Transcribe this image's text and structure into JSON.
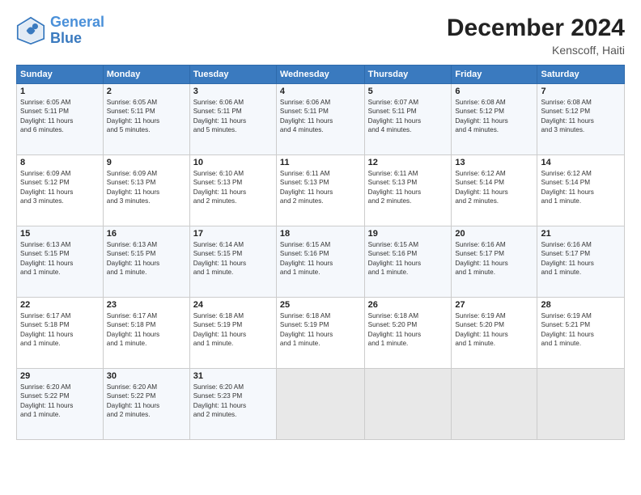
{
  "header": {
    "logo_line1": "General",
    "logo_line2": "Blue",
    "month_title": "December 2024",
    "location": "Kenscoff, Haiti"
  },
  "days_of_week": [
    "Sunday",
    "Monday",
    "Tuesday",
    "Wednesday",
    "Thursday",
    "Friday",
    "Saturday"
  ],
  "weeks": [
    [
      {
        "day": "1",
        "info": "Sunrise: 6:05 AM\nSunset: 5:11 PM\nDaylight: 11 hours\nand 6 minutes."
      },
      {
        "day": "2",
        "info": "Sunrise: 6:05 AM\nSunset: 5:11 PM\nDaylight: 11 hours\nand 5 minutes."
      },
      {
        "day": "3",
        "info": "Sunrise: 6:06 AM\nSunset: 5:11 PM\nDaylight: 11 hours\nand 5 minutes."
      },
      {
        "day": "4",
        "info": "Sunrise: 6:06 AM\nSunset: 5:11 PM\nDaylight: 11 hours\nand 4 minutes."
      },
      {
        "day": "5",
        "info": "Sunrise: 6:07 AM\nSunset: 5:11 PM\nDaylight: 11 hours\nand 4 minutes."
      },
      {
        "day": "6",
        "info": "Sunrise: 6:08 AM\nSunset: 5:12 PM\nDaylight: 11 hours\nand 4 minutes."
      },
      {
        "day": "7",
        "info": "Sunrise: 6:08 AM\nSunset: 5:12 PM\nDaylight: 11 hours\nand 3 minutes."
      }
    ],
    [
      {
        "day": "8",
        "info": "Sunrise: 6:09 AM\nSunset: 5:12 PM\nDaylight: 11 hours\nand 3 minutes."
      },
      {
        "day": "9",
        "info": "Sunrise: 6:09 AM\nSunset: 5:13 PM\nDaylight: 11 hours\nand 3 minutes."
      },
      {
        "day": "10",
        "info": "Sunrise: 6:10 AM\nSunset: 5:13 PM\nDaylight: 11 hours\nand 2 minutes."
      },
      {
        "day": "11",
        "info": "Sunrise: 6:11 AM\nSunset: 5:13 PM\nDaylight: 11 hours\nand 2 minutes."
      },
      {
        "day": "12",
        "info": "Sunrise: 6:11 AM\nSunset: 5:13 PM\nDaylight: 11 hours\nand 2 minutes."
      },
      {
        "day": "13",
        "info": "Sunrise: 6:12 AM\nSunset: 5:14 PM\nDaylight: 11 hours\nand 2 minutes."
      },
      {
        "day": "14",
        "info": "Sunrise: 6:12 AM\nSunset: 5:14 PM\nDaylight: 11 hours\nand 1 minute."
      }
    ],
    [
      {
        "day": "15",
        "info": "Sunrise: 6:13 AM\nSunset: 5:15 PM\nDaylight: 11 hours\nand 1 minute."
      },
      {
        "day": "16",
        "info": "Sunrise: 6:13 AM\nSunset: 5:15 PM\nDaylight: 11 hours\nand 1 minute."
      },
      {
        "day": "17",
        "info": "Sunrise: 6:14 AM\nSunset: 5:15 PM\nDaylight: 11 hours\nand 1 minute."
      },
      {
        "day": "18",
        "info": "Sunrise: 6:15 AM\nSunset: 5:16 PM\nDaylight: 11 hours\nand 1 minute."
      },
      {
        "day": "19",
        "info": "Sunrise: 6:15 AM\nSunset: 5:16 PM\nDaylight: 11 hours\nand 1 minute."
      },
      {
        "day": "20",
        "info": "Sunrise: 6:16 AM\nSunset: 5:17 PM\nDaylight: 11 hours\nand 1 minute."
      },
      {
        "day": "21",
        "info": "Sunrise: 6:16 AM\nSunset: 5:17 PM\nDaylight: 11 hours\nand 1 minute."
      }
    ],
    [
      {
        "day": "22",
        "info": "Sunrise: 6:17 AM\nSunset: 5:18 PM\nDaylight: 11 hours\nand 1 minute."
      },
      {
        "day": "23",
        "info": "Sunrise: 6:17 AM\nSunset: 5:18 PM\nDaylight: 11 hours\nand 1 minute."
      },
      {
        "day": "24",
        "info": "Sunrise: 6:18 AM\nSunset: 5:19 PM\nDaylight: 11 hours\nand 1 minute."
      },
      {
        "day": "25",
        "info": "Sunrise: 6:18 AM\nSunset: 5:19 PM\nDaylight: 11 hours\nand 1 minute."
      },
      {
        "day": "26",
        "info": "Sunrise: 6:18 AM\nSunset: 5:20 PM\nDaylight: 11 hours\nand 1 minute."
      },
      {
        "day": "27",
        "info": "Sunrise: 6:19 AM\nSunset: 5:20 PM\nDaylight: 11 hours\nand 1 minute."
      },
      {
        "day": "28",
        "info": "Sunrise: 6:19 AM\nSunset: 5:21 PM\nDaylight: 11 hours\nand 1 minute."
      }
    ],
    [
      {
        "day": "29",
        "info": "Sunrise: 6:20 AM\nSunset: 5:22 PM\nDaylight: 11 hours\nand 1 minute."
      },
      {
        "day": "30",
        "info": "Sunrise: 6:20 AM\nSunset: 5:22 PM\nDaylight: 11 hours\nand 2 minutes."
      },
      {
        "day": "31",
        "info": "Sunrise: 6:20 AM\nSunset: 5:23 PM\nDaylight: 11 hours\nand 2 minutes."
      },
      {
        "day": "",
        "info": ""
      },
      {
        "day": "",
        "info": ""
      },
      {
        "day": "",
        "info": ""
      },
      {
        "day": "",
        "info": ""
      }
    ]
  ]
}
